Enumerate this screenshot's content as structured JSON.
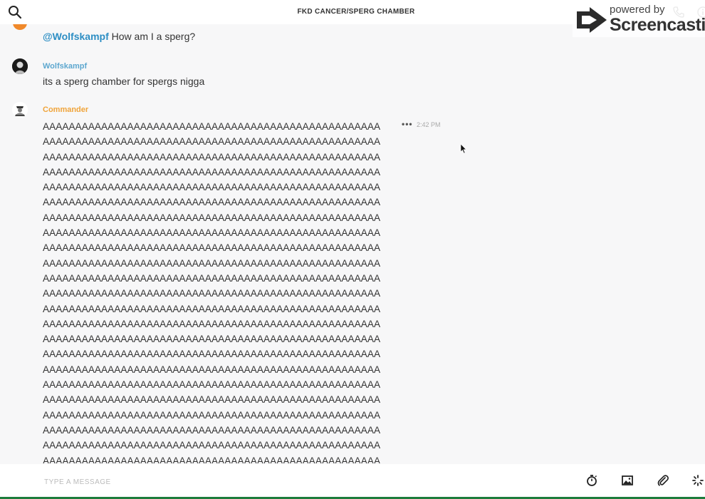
{
  "header": {
    "title": "FKD CANCER/SPERG CHAMBER"
  },
  "watermark": {
    "powered": "powered by",
    "brand": "Screencastify"
  },
  "messages": {
    "mention_msg": {
      "mention": "@Wolfskampf",
      "text": " How am I a sperg?"
    },
    "wolf_msg": {
      "author": "Wolfskampf",
      "text": "its a sperg chamber for spergs nigga"
    },
    "cmd_msg": {
      "author": "Commander",
      "timestamp": "2:42 PM",
      "more": "•••",
      "lines": [
        "AAAAAAAAAAAAAAAAAAAAAAAAAAAAAAAAAAAAAAAAAAAAAAAAAAAA",
        "AAAAAAAAAAAAAAAAAAAAAAAAAAAAAAAAAAAAAAAAAAAAAAAAAAAA",
        "AAAAAAAAAAAAAAAAAAAAAAAAAAAAAAAAAAAAAAAAAAAAAAAAAAAA",
        "AAAAAAAAAAAAAAAAAAAAAAAAAAAAAAAAAAAAAAAAAAAAAAAAAAAA",
        "AAAAAAAAAAAAAAAAAAAAAAAAAAAAAAAAAAAAAAAAAAAAAAAAAAAA",
        "AAAAAAAAAAAAAAAAAAAAAAAAAAAAAAAAAAAAAAAAAAAAAAAAAAAA",
        "AAAAAAAAAAAAAAAAAAAAAAAAAAAAAAAAAAAAAAAAAAAAAAAAAAAA",
        "AAAAAAAAAAAAAAAAAAAAAAAAAAAAAAAAAAAAAAAAAAAAAAAAAAAA",
        "AAAAAAAAAAAAAAAAAAAAAAAAAAAAAAAAAAAAAAAAAAAAAAAAAAAA",
        "AAAAAAAAAAAAAAAAAAAAAAAAAAAAAAAAAAAAAAAAAAAAAAAAAAAA",
        "AAAAAAAAAAAAAAAAAAAAAAAAAAAAAAAAAAAAAAAAAAAAAAAAAAAA",
        "AAAAAAAAAAAAAAAAAAAAAAAAAAAAAAAAAAAAAAAAAAAAAAAAAAAA",
        "AAAAAAAAAAAAAAAAAAAAAAAAAAAAAAAAAAAAAAAAAAAAAAAAAAAA",
        "AAAAAAAAAAAAAAAAAAAAAAAAAAAAAAAAAAAAAAAAAAAAAAAAAAAA",
        "AAAAAAAAAAAAAAAAAAAAAAAAAAAAAAAAAAAAAAAAAAAAAAAAAAAA",
        "AAAAAAAAAAAAAAAAAAAAAAAAAAAAAAAAAAAAAAAAAAAAAAAAAAAA",
        "AAAAAAAAAAAAAAAAAAAAAAAAAAAAAAAAAAAAAAAAAAAAAAAAAAAA",
        "AAAAAAAAAAAAAAAAAAAAAAAAAAAAAAAAAAAAAAAAAAAAAAAAAAAA",
        "AAAAAAAAAAAAAAAAAAAAAAAAAAAAAAAAAAAAAAAAAAAAAAAAAAAA",
        "AAAAAAAAAAAAAAAAAAAAAAAAAAAAAAAAAAAAAAAAAAAAAAAAAAAA",
        "AAAAAAAAAAAAAAAAAAAAAAAAAAAAAAAAAAAAAAAAAAAAAAAAAAAA",
        "AAAAAAAAAAAAAAAAAAAAAAAAAAAAAAAAAAAAAAAAAAAAAAAAAAAA",
        "AAAAAAAAAAAAAAAAAAAAAAAAAAAAAAAAAAAAAAAAAAAAAAAAAAAA"
      ]
    }
  },
  "composer": {
    "placeholder": "TYPE A MESSAGE",
    "value": ""
  },
  "icons": {
    "search": "search-icon",
    "phone": "phone-icon",
    "info": "info-icon",
    "timer": "timer-icon",
    "image": "image-icon",
    "attach": "paperclip-icon",
    "spinner": "spinner-icon"
  },
  "colors": {
    "mention": "#2d8ec4",
    "wolf_name": "#5da7cf",
    "commander_name": "#f0a43a",
    "avatar_orange": "#f0892b",
    "bottom_bar": "#1c7c3c"
  }
}
